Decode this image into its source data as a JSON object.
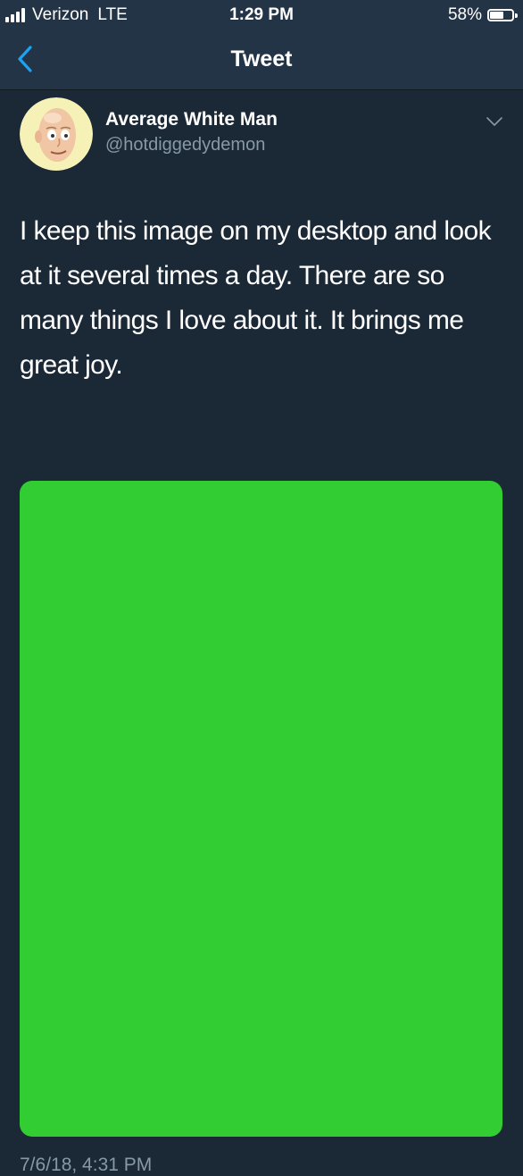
{
  "status_bar": {
    "carrier": "Verizon",
    "network": "LTE",
    "time": "1:29 PM",
    "battery_text": "58%",
    "battery_level": 0.58
  },
  "nav": {
    "title": "Tweet",
    "back_icon": "chevron-left-icon"
  },
  "tweet": {
    "author_name": "Average White Man",
    "author_handle": "@hotdiggedydemon",
    "text": "I keep this image on my desktop and look at it several times a day. There are so many things I love about it. It brings me great joy.",
    "media_color": "#32cd32",
    "timestamp": "7/6/18, 4:31 PM",
    "menu_icon": "chevron-down-icon"
  },
  "colors": {
    "background": "#1b2836",
    "header": "#243447",
    "accent": "#1da1f2",
    "secondary_text": "#8899a6"
  }
}
